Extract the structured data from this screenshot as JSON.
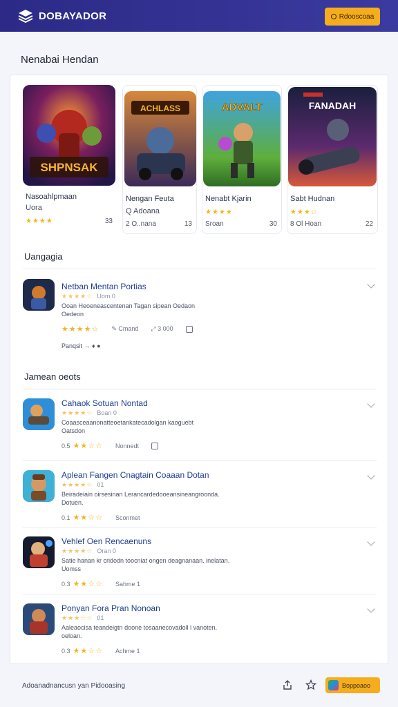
{
  "app": {
    "brand": "DOBAYADOR",
    "top_button": "Rdooscoaa"
  },
  "page_title": "Nenabai Hendan",
  "featured": [
    {
      "name": "Nasoahlpmaan",
      "sub": "Uora",
      "stars": "★★★★",
      "meta": "",
      "count": "33",
      "art_title": "SHPNSAK"
    },
    {
      "name": "Nengan Feuta",
      "sub": "Q Adoana",
      "stars": "",
      "meta": "2 O..nana",
      "count": "13",
      "art_title": "ACHLASS"
    },
    {
      "name": "Nenabt Kjarin",
      "sub": "",
      "stars": "★★★★",
      "meta": "Sroan",
      "count": "30",
      "art_title": "ADVALT"
    },
    {
      "name": "Sabt Hudnan",
      "sub": "",
      "stars": "★★★☆",
      "meta": "8 Ol Hoan",
      "count": "22",
      "art_title": "FANADAH"
    }
  ],
  "upgrade_section": {
    "heading": "Uangagia",
    "item": {
      "title": "Netban Mentan Portias",
      "stars_small": "★★★★☆",
      "sub": "Uom  0",
      "desc_line1": "Ooan Heoeneascentenan Tagan sipean Oedaon",
      "desc_line2": "Oedeon",
      "stars": "★★★★☆",
      "meta1": "Cmand",
      "meta2": "3 000",
      "footer": "Panqsit"
    }
  },
  "list_section": {
    "heading": "Jamean oeots",
    "items": [
      {
        "title": "Cahaok Sotuan Nontad",
        "stars_small": "★★★★☆",
        "sub": "Boan 0",
        "desc_line1": "Coaasceaanonatteoetankatecadolgan kaoguebt",
        "desc_line2": "Oatsdon",
        "rating": "0.5",
        "stars": "★★☆☆",
        "meta": "Nonnedt"
      },
      {
        "title": "Aplean Fangen Cnagtain Coaaan Dotan",
        "stars_small": "★★★★☆",
        "sub": "01",
        "desc_line1": "Beiradeiain oirsesinan Lerancardedooeansineangroonda.",
        "desc_line2": "Dotuen.",
        "rating": "0.1",
        "stars": "★★☆☆",
        "meta": "Sconmet"
      },
      {
        "title": "Vehlef Oen Rencaenuns",
        "stars_small": "★★★★☆",
        "sub": "Oran 0",
        "desc_line1": "Satie hanan kr cridodn toocniat ongen deagnanaan. inelatan.",
        "desc_line2": "Uomss",
        "rating": "0.3",
        "stars": "★★☆☆",
        "meta": "Sahme 1"
      },
      {
        "title": "Ponyan Fora Pran Nonoan",
        "stars_small": "★★★☆☆",
        "sub": "01",
        "desc_line1": "Aaleaocisa teandeigtn doone tosaanecovadoll l vanoten.",
        "desc_line2": "oeloan.",
        "rating": "0.3",
        "stars": "★★☆☆",
        "meta": "Achme 1"
      }
    ]
  },
  "footer": {
    "text": "Adoanadnancusn   yan  Pidooasing",
    "button": "Boppoaoo"
  },
  "colors": {
    "topbar": "#2c2a86",
    "accent": "#f6ad1d",
    "link": "#1e3f8f",
    "star": "#f3b41b"
  }
}
